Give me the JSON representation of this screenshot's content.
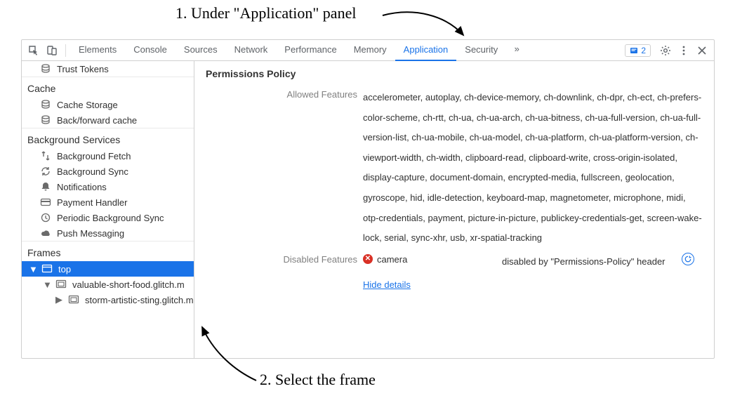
{
  "annotations": {
    "top": "1. Under \"Application\" panel",
    "bottom": "2. Select the frame"
  },
  "toolbar": {
    "tabs": [
      "Elements",
      "Console",
      "Sources",
      "Network",
      "Performance",
      "Memory",
      "Application",
      "Security"
    ],
    "active_tab_index": 6,
    "issues_count": "2"
  },
  "sidebar": {
    "top_item": "Trust Tokens",
    "sections": [
      {
        "title": "Cache",
        "items": [
          {
            "icon": "db-icon",
            "label": "Cache Storage"
          },
          {
            "icon": "db-icon",
            "label": "Back/forward cache"
          }
        ]
      },
      {
        "title": "Background Services",
        "items": [
          {
            "icon": "fetch-icon",
            "label": "Background Fetch"
          },
          {
            "icon": "sync-icon",
            "label": "Background Sync"
          },
          {
            "icon": "bell-icon",
            "label": "Notifications"
          },
          {
            "icon": "card-icon",
            "label": "Payment Handler"
          },
          {
            "icon": "clock-icon",
            "label": "Periodic Background Sync"
          },
          {
            "icon": "cloud-icon",
            "label": "Push Messaging"
          }
        ]
      },
      {
        "title": "Frames",
        "tree": {
          "root": {
            "label": "top",
            "selected": true
          },
          "children": [
            {
              "label": "valuable-short-food.glitch.m"
            },
            {
              "label": "storm-artistic-sting.glitch.m"
            }
          ]
        }
      }
    ]
  },
  "main": {
    "title": "Permissions Policy",
    "allowed_label": "Allowed Features",
    "allowed_features": "accelerometer, autoplay, ch-device-memory, ch-downlink, ch-dpr, ch-ect, ch-prefers-color-scheme, ch-rtt, ch-ua, ch-ua-arch, ch-ua-bitness, ch-ua-full-version, ch-ua-full-version-list, ch-ua-mobile, ch-ua-model, ch-ua-platform, ch-ua-platform-version, ch-viewport-width, ch-width, clipboard-read, clipboard-write, cross-origin-isolated, display-capture, document-domain, encrypted-media, fullscreen, geolocation, gyroscope, hid, idle-detection, keyboard-map, magnetometer, microphone, midi, otp-credentials, payment, picture-in-picture, publickey-credentials-get, screen-wake-lock, serial, sync-xhr, usb, xr-spatial-tracking",
    "disabled_label": "Disabled Features",
    "disabled_feature": {
      "name": "camera",
      "reason": "disabled by \"Permissions-Policy\" header"
    },
    "hide_details": "Hide details"
  }
}
